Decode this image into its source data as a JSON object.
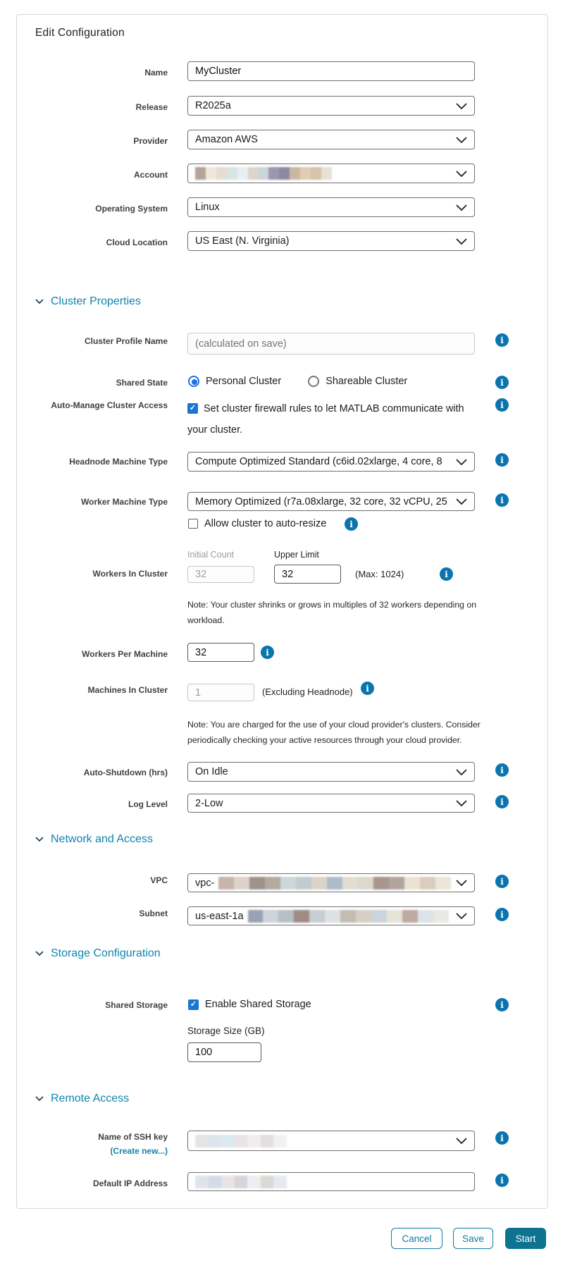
{
  "title": "Edit Configuration",
  "icons": {
    "info": "i",
    "check": "✓"
  },
  "colors": {
    "accent": "#0d7390",
    "section_header": "#0f84b0",
    "info_icon": "#0b74ad",
    "selection_blue": "#1a73e8"
  },
  "fields": {
    "name": {
      "label": "Name",
      "value": "MyCluster"
    },
    "release": {
      "label": "Release",
      "value": "R2025a"
    },
    "provider": {
      "label": "Provider",
      "value": "Amazon AWS"
    },
    "account": {
      "label": "Account"
    },
    "os": {
      "label": "Operating System",
      "value": "Linux"
    },
    "cloud_location": {
      "label": "Cloud Location",
      "value": "US East (N. Virginia)"
    }
  },
  "cluster_properties": {
    "title": "Cluster Properties",
    "profile": {
      "label": "Cluster Profile Name",
      "placeholder": "(calculated on save)"
    },
    "shared_state": {
      "label": "Shared State",
      "option1": "Personal Cluster",
      "option2": "Shareable Cluster"
    },
    "auto_manage": {
      "label": "Auto-Manage Cluster Access",
      "text": "Set cluster firewall rules to let MATLAB communicate with your cluster."
    },
    "headnode": {
      "label": "Headnode Machine Type",
      "value": "Compute Optimized Standard (c6id.02xlarge, 4 core, 8"
    },
    "worker": {
      "label": "Worker Machine Type",
      "value": "Memory Optimized (r7a.08xlarge, 32 core, 32 vCPU, 25"
    },
    "auto_resize": {
      "text": "Allow cluster to auto-resize"
    },
    "workers": {
      "label": "Workers In Cluster",
      "initial_label": "Initial Count",
      "initial_value": "32",
      "upper_label": "Upper Limit",
      "upper_value": "32",
      "max_hint": "(Max: 1024)",
      "note": "Note: Your cluster shrinks or grows in multiples of 32 workers depending on workload."
    },
    "per_machine": {
      "label": "Workers Per Machine",
      "value": "32"
    },
    "machines": {
      "label": "Machines In Cluster",
      "value": "1",
      "hint": "(Excluding Headnode)",
      "note": "Note: You are charged for the use of your cloud provider's clusters. Consider periodically checking your active resources through your cloud provider."
    },
    "auto_shutdown": {
      "label": "Auto-Shutdown (hrs)",
      "value": "On Idle"
    },
    "log_level": {
      "label": "Log Level",
      "value": "2-Low"
    }
  },
  "network": {
    "title": "Network and Access",
    "vpc": {
      "label": "VPC",
      "value_prefix": "vpc-"
    },
    "subnet": {
      "label": "Subnet",
      "value_prefix": "us-east-1a"
    }
  },
  "storage": {
    "title": "Storage Configuration",
    "shared": {
      "label": "Shared Storage",
      "checkbox_label": "Enable Shared Storage"
    },
    "size": {
      "label": "Storage Size (GB)",
      "value": "100"
    }
  },
  "remote": {
    "title": "Remote Access",
    "ssh": {
      "label": "Name of SSH key",
      "create_new": "(Create new...)"
    },
    "ip": {
      "label": "Default IP Address"
    }
  },
  "footer": {
    "cancel": "Cancel",
    "save": "Save",
    "start": "Start"
  },
  "redactions": {
    "account": [
      "#b4a39a",
      "#efe8da",
      "#e6ddd2",
      "#d8e5e3",
      "#e9eef0",
      "#dcd5cc",
      "#ccd4dc",
      "#9d96ad",
      "#8e88a5",
      "#c9b8a1",
      "#e2cdb0",
      "#d5c3ac",
      "#e8e1d7"
    ],
    "vpc": [
      "#c7b4ab",
      "#ddd2ca",
      "#9d938c",
      "#b4aa9d",
      "#ced7d9",
      "#c2ccd0",
      "#dbd3c9",
      "#acbcc8",
      "#e2dcd1",
      "#ddd8cd",
      "#a7968e",
      "#b2a39d",
      "#ebe3d1",
      "#d9cdbf",
      "#eae6da"
    ],
    "subnet": [
      "#99a2b4",
      "#ced2d9",
      "#b7bec6",
      "#9f8b84",
      "#c7ced1",
      "#dee1e1",
      "#c4bcb1",
      "#d7cec5",
      "#cad4dc",
      "#e7e3d9",
      "#bfa9a3",
      "#dbe3e9",
      "#e8e8e4"
    ],
    "ssh": [
      "#e4e4e4",
      "#dfe4ec",
      "#dce9f2",
      "#e8e3e4",
      "#f0eded",
      "#e5dede",
      "#eff1f2"
    ],
    "ip": [
      "#dfe3ea",
      "#d3dce8",
      "#e8e4e6",
      "#d9d3dd",
      "#eceef0",
      "#dcd8d4",
      "#e6eaee"
    ]
  }
}
